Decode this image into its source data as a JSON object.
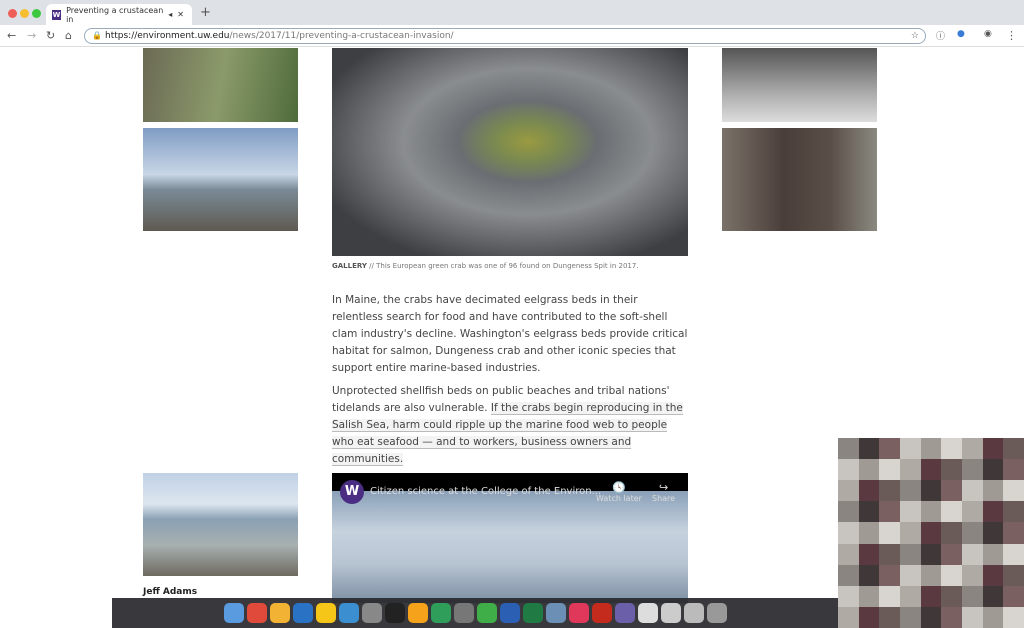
{
  "browser": {
    "tab_title": "Preventing a crustacean in",
    "tab_favicon": "W",
    "url_host": "https://environment.uw.edu",
    "url_path": "/news/2017/11/preventing-a-crustacean-invasion/"
  },
  "article": {
    "caption_label": "GALLERY",
    "caption_text": " // This European green crab was one of 96 found on Dungeness Spit in 2017.",
    "para1": "In Maine, the crabs have decimated eelgrass beds in their relentless search for food and have contributed to the soft-shell clam industry's decline. Washington's eelgrass beds provide critical habitat for salmon, Dungeness crab and other iconic species that support entire marine-based industries.",
    "para2_start": "Unprotected shellfish beds on public beaches and tribal nations' tidelands are also vulnerable. ",
    "para2_link": "If the crabs begin reproducing in the Salish Sea, harm could ripple up the marine food web to people who eat seafood — and to workers, business owners and communities.",
    "person_name": "Jeff Adams"
  },
  "video": {
    "logo": "W",
    "title": "Citizen science at the College of the Environ...",
    "watch_later": "Watch later",
    "share": "Share"
  },
  "dock_colors": [
    "#5a9be0",
    "#e04a3a",
    "#f2b233",
    "#2a72c4",
    "#f5c518",
    "#3b8fd0",
    "#888",
    "#222",
    "#f7a21b",
    "#2e9e5a",
    "#777",
    "#3fae49",
    "#2b5fb3",
    "#1f7a44",
    "#6b8fb5",
    "#e0385b",
    "#c42b1c",
    "#6a5fa8",
    "#ddd",
    "#ccc",
    "#bbb",
    "#999"
  ]
}
